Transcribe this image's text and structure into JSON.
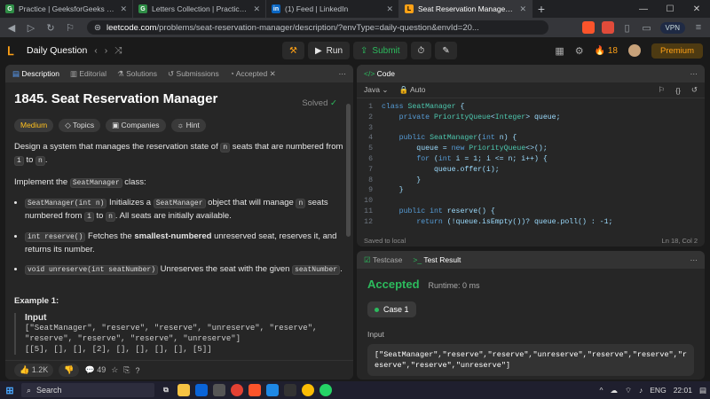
{
  "browser": {
    "tabs": [
      {
        "title": "Practice | GeeksforGeeks | A computer",
        "fav": "G"
      },
      {
        "title": "Letters Collection | Practice | GeeksforGeeks",
        "fav": "G"
      },
      {
        "title": "(1) Feed | LinkedIn",
        "fav": "in"
      },
      {
        "title": "Seat Reservation Manager - LeetCode",
        "fav": "L"
      }
    ],
    "url_domain": "leetcode.com",
    "url_path": "/problems/seat-reservation-manager/description/?envType=daily-question&envId=20...",
    "vpn": "VPN"
  },
  "lc": {
    "daily_label": "Daily Question",
    "run": "Run",
    "submit": "Submit",
    "streak": "18",
    "premium": "Premium"
  },
  "left_tabs": [
    "Description",
    "Editorial",
    "Solutions",
    "Submissions",
    "Accepted"
  ],
  "problem": {
    "title": "1845. Seat Reservation Manager",
    "solved": "Solved",
    "tags": [
      "Medium",
      "Topics",
      "Companies",
      "Hint"
    ],
    "intro_a": "Design a system that manages the reservation state of ",
    "intro_n": "n",
    "intro_b": " seats that are numbered from ",
    "intro_1": "1",
    "intro_c": " to ",
    "intro_n2": "n",
    "intro_d": ".",
    "impl_a": "Implement the ",
    "impl_code": "SeatManager",
    "impl_b": " class:",
    "d1_code": "SeatManager(int n)",
    "d1_a": " Initializes a ",
    "d1_code2": "SeatManager",
    "d1_b": " object that will manage ",
    "d1_n": "n",
    "d1_c": " seats numbered from ",
    "d1_1": "1",
    "d1_d": " to ",
    "d1_n2": "n",
    "d1_e": ". All seats are initially available.",
    "d2_code": "int reserve()",
    "d2_a": " Fetches the ",
    "d2_bold": "smallest-numbered",
    "d2_b": " unreserved seat, reserves it, and returns its number.",
    "d3_code": "void unreserve(int seatNumber)",
    "d3_a": " Unreserves the seat with the given ",
    "d3_code2": "seatNumber",
    "d3_b": ".",
    "example_title": "Example 1:",
    "input_label": "Input",
    "input_text": "[\"SeatManager\", \"reserve\", \"reserve\", \"unreserve\", \"reserve\",\n\"reserve\", \"reserve\", \"reserve\", \"unreserve\"]\n[[5], [], [], [2], [], [], [], [], [5]]"
  },
  "desc_footer": {
    "likes": "1.2K",
    "comments": "49"
  },
  "code": {
    "header": "Code",
    "lang": "Java",
    "mode": "Auto",
    "status_left": "Saved to local",
    "status_right": "Ln 18, Col 2"
  },
  "result": {
    "tabs": [
      "Testcase",
      "Test Result"
    ],
    "verdict": "Accepted",
    "runtime": "Runtime: 0 ms",
    "case": "Case 1",
    "input_label": "Input",
    "input_value": "[\"SeatManager\",\"reserve\",\"reserve\",\"unreserve\",\"reserve\",\"reserve\",\"reserve\",\"reserve\",\"unreserve\"]"
  },
  "taskbar": {
    "search": "Search",
    "lang": "ENG",
    "time": "22:01"
  }
}
